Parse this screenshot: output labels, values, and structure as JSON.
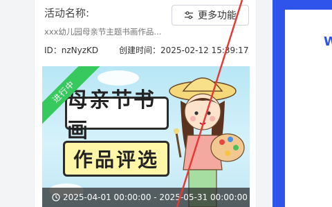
{
  "card": {
    "activity_label": "活动名称:",
    "more_button_label": "更多功能",
    "activity_name": "xxx幼儿园母亲节主题书画作品...",
    "id_text": "ID：nzNyzKD",
    "created_text": "创建时间：2025-02-12 15:39:17"
  },
  "poster": {
    "status_ribbon": "进行中",
    "title_line1": "母亲节书画",
    "title_line2": "作品评选",
    "date_range": "2025-04-01 00:00:00 - 2025-05-31 00:00:00"
  },
  "right_panel": {
    "partial_letter": "W"
  },
  "colors": {
    "accent": "#2f54eb",
    "ribbon": "#37c85e",
    "annotation_line": "#e53935"
  }
}
